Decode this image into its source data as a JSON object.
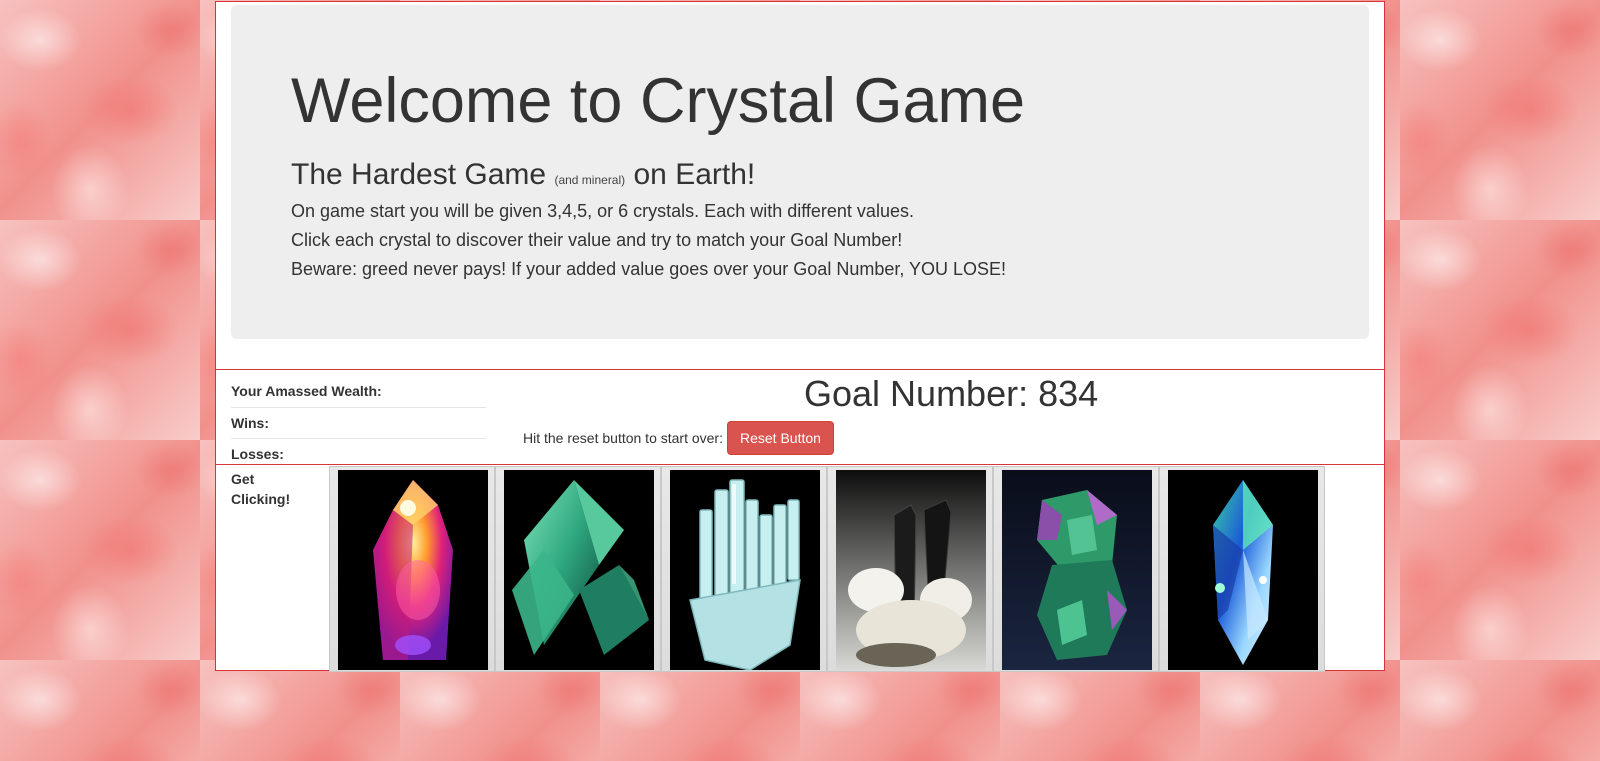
{
  "jumbotron": {
    "title": "Welcome to Crystal Game",
    "subtitle_main": "The Hardest Game",
    "subtitle_small": "(and mineral)",
    "subtitle_end": "on Earth!",
    "line1": "On game start you will be given 3,4,5, or 6 crystals. Each with different values.",
    "line2": "Click each crystal to discover their value and try to match your Goal Number!",
    "line3": "Beware: greed never pays! If your added value goes over your Goal Number, YOU LOSE!"
  },
  "stats": {
    "wealth_label": "Your Amassed Wealth:",
    "wealth_value": "",
    "wins_label": "Wins:",
    "wins_value": "",
    "losses_label": "Losses:",
    "losses_value": ""
  },
  "goal": {
    "label": "Goal Number: 834"
  },
  "reset": {
    "hint": "Hit the reset button to start over:",
    "button_label": "Reset Button"
  },
  "crystals": {
    "header": "Get Clicking!",
    "items": [
      {
        "name": "rainbow-quartz-crystal-icon"
      },
      {
        "name": "green-fluorite-crystal-icon"
      },
      {
        "name": "aquamarine-crystal-icon"
      },
      {
        "name": "black-tourmaline-crystal-icon"
      },
      {
        "name": "multicolor-fluorite-crystal-icon"
      },
      {
        "name": "opal-crystal-icon"
      }
    ]
  },
  "colors": {
    "border_red": "#d9333a",
    "button_red": "#d9534f",
    "jumbotron_bg": "#eeeeee",
    "background_pink": "#f4b0ad"
  }
}
